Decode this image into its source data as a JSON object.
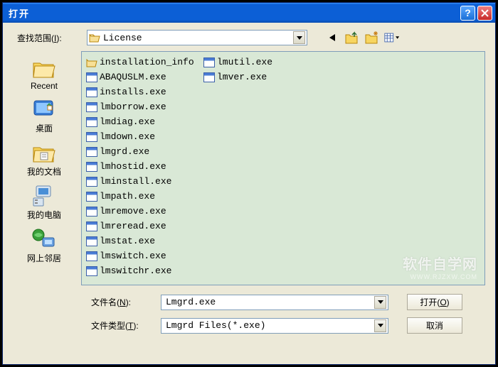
{
  "titlebar": {
    "title": "打开"
  },
  "lookin": {
    "label": "查找范围",
    "hotkey": "I",
    "value": "License"
  },
  "sidebar": {
    "items": [
      {
        "label": "Recent"
      },
      {
        "label": "桌面"
      },
      {
        "label": "我的文档"
      },
      {
        "label": "我的电脑"
      },
      {
        "label": "网上邻居"
      }
    ]
  },
  "files": {
    "col1": [
      {
        "name": "installation_info",
        "type": "folder"
      },
      {
        "name": "ABAQUSLM.exe",
        "type": "exe"
      },
      {
        "name": "installs.exe",
        "type": "exe"
      },
      {
        "name": "lmborrow.exe",
        "type": "exe"
      },
      {
        "name": "lmdiag.exe",
        "type": "exe"
      },
      {
        "name": "lmdown.exe",
        "type": "exe"
      },
      {
        "name": "lmgrd.exe",
        "type": "exe"
      },
      {
        "name": "lmhostid.exe",
        "type": "exe"
      },
      {
        "name": "lminstall.exe",
        "type": "exe"
      },
      {
        "name": "lmpath.exe",
        "type": "exe"
      },
      {
        "name": "lmremove.exe",
        "type": "exe"
      },
      {
        "name": "lmreread.exe",
        "type": "exe"
      },
      {
        "name": "lmstat.exe",
        "type": "exe"
      },
      {
        "name": "lmswitch.exe",
        "type": "exe"
      },
      {
        "name": "lmswitchr.exe",
        "type": "exe"
      }
    ],
    "col2": [
      {
        "name": "lmutil.exe",
        "type": "exe"
      },
      {
        "name": "lmver.exe",
        "type": "exe"
      }
    ]
  },
  "filename": {
    "label": "文件名",
    "hotkey": "N",
    "value": "Lmgrd.exe"
  },
  "filetype": {
    "label": "文件类型",
    "hotkey": "T",
    "value": "Lmgrd Files(*.exe)"
  },
  "buttons": {
    "open": "打开",
    "open_hotkey": "O",
    "cancel": "取消"
  },
  "watermark": {
    "big": "软件自学网",
    "small": "WWW.RJZXW.COM"
  }
}
